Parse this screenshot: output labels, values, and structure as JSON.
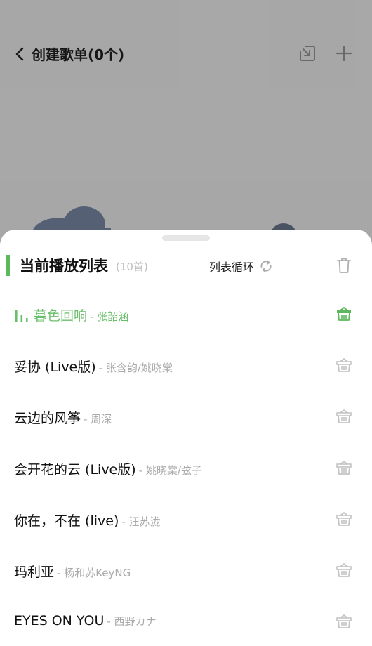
{
  "background": {
    "title": "创建歌单(0个)",
    "back_icon": "chevron-left-icon",
    "import_icon": "import-icon",
    "add_icon": "plus-icon"
  },
  "sheet": {
    "title": "当前播放列表",
    "count": "(10首)",
    "loop_mode": "列表循环",
    "accent_color": "#5cb85c"
  },
  "songs": [
    {
      "title": "暮色回响",
      "artist": "- 张韶涵",
      "playing": true
    },
    {
      "title": "妥协 (Live版)",
      "artist": "- 张含韵/姚晓棠",
      "playing": false
    },
    {
      "title": "云边的风筝",
      "artist": "- 周深",
      "playing": false
    },
    {
      "title": "会开花的云 (Live版)",
      "artist": "- 姚晓棠/弦子",
      "playing": false
    },
    {
      "title": "你在，不在 (live)",
      "artist": "- 汪苏泷",
      "playing": false
    },
    {
      "title": "玛利亚",
      "artist": "- 杨和苏KeyNG",
      "playing": false
    },
    {
      "title": "EYES ON YOU",
      "artist": "- 西野カナ",
      "playing": false
    }
  ]
}
